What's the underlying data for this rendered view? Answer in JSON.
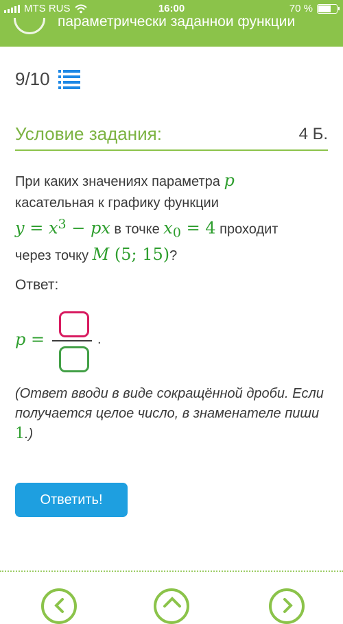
{
  "status_bar": {
    "carrier": "MTS RUS",
    "time": "16:00",
    "battery": "70 %",
    "battery_level": 0.7
  },
  "header": {
    "title": "параметрически заданной функции"
  },
  "progress": {
    "text": "9/10"
  },
  "condition": {
    "label": "Условие задания:",
    "points": "4 Б."
  },
  "question": {
    "t1": "При каких значениях параметра ",
    "param": "p",
    "t2": "касательная к графику функции",
    "y": "y",
    "eq": " = ",
    "x": "x",
    "exp": "3",
    "minus": " − ",
    "px": "px",
    "t3": " в точке ",
    "x0": "x",
    "sub0": "0",
    "eq2": " = 4",
    "t4": " проходит",
    "t5": "через точку ",
    "M": "M",
    "point": " (5; 15)",
    "t6": "?"
  },
  "answer": {
    "label": "Ответ:",
    "lhs": "p",
    "eq": " =",
    "period": "."
  },
  "hint": {
    "text": "(Ответ вводи в виде сокращённой дроби. Если получается целое число, в знаменателе пиши ",
    "num": "1",
    "end": ".)"
  },
  "submit": {
    "label": "Ответить!"
  },
  "colors": {
    "accent_green": "#8bc34a",
    "math_green": "#2e9e2e",
    "button_blue": "#1e9fe0",
    "numerator_box": "#d81b60",
    "denominator_box": "#43a047"
  }
}
